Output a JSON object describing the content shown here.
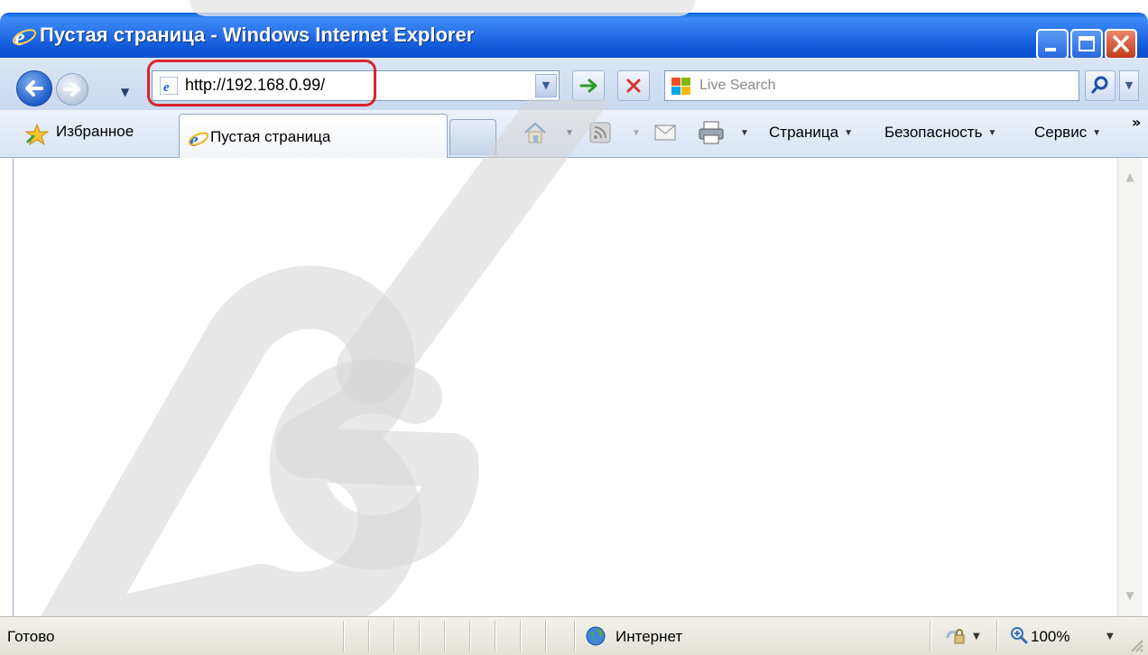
{
  "window": {
    "title": "Пустая страница - Windows Internet Explorer"
  },
  "address_bar": {
    "url": "http://192.168.0.99/",
    "highlight_color": "#d9232e"
  },
  "search": {
    "placeholder": "Live Search"
  },
  "toolbar": {
    "favorites_label": "Избранное",
    "tab_label": "Пустая страница",
    "page_menu": "Страница",
    "safety_menu": "Безопасность",
    "tools_menu": "Сервис",
    "overflow": "»"
  },
  "status": {
    "text": "Готово",
    "zone": "Интернет",
    "zoom": "100%"
  },
  "colors": {
    "titlebar": "#2a72ea",
    "close_button": "#c43b1c"
  }
}
